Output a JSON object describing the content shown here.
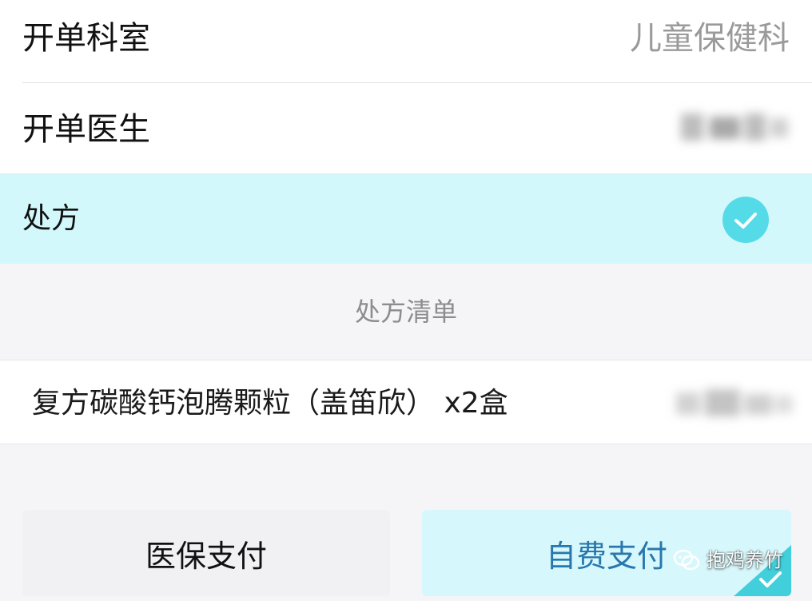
{
  "info_rows": [
    {
      "label": "开单科室",
      "value": "儿童保健科"
    },
    {
      "label": "开单医生",
      "value": ""
    }
  ],
  "prescription": {
    "label": "处方",
    "selected": true,
    "check_icon": "check-circle-icon"
  },
  "prescription_list": {
    "title": "处方清单",
    "items": [
      {
        "name": "复方碳酸钙泡腾颗粒（盖笛欣） x2盒"
      }
    ]
  },
  "payment": {
    "insurance_label": "医保支付",
    "self_pay_label": "自费支付",
    "selected": "self_pay"
  },
  "watermark": {
    "text": "抱鸡养竹",
    "icon": "wechat-icon"
  },
  "colors": {
    "selected_row_bg": "#d3f8fb",
    "check_circle": "#55dbe8",
    "self_pay_bg": "#d6f7fb",
    "self_pay_text": "#2877ad",
    "corner_badge": "#41cfdb"
  }
}
